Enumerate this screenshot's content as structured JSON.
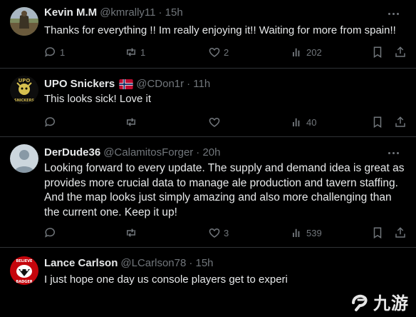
{
  "tweets": [
    {
      "name": "Kevin M.M",
      "handle": "@kmrally11",
      "time": "· 15h",
      "text": "Thanks for everything !! Im really enjoying it!! Waiting for more from spain!!",
      "replies": "1",
      "retweets": "1",
      "likes": "2",
      "views": "202"
    },
    {
      "name": "UPO Snickers",
      "handle": "@CDon1r",
      "time": "· 11h",
      "text": "This looks sick! Love it",
      "replies": "",
      "retweets": "",
      "likes": "",
      "views": "40"
    },
    {
      "name": "DerDude36",
      "handle": "@CalamitosForger",
      "time": "· 20h",
      "text": "Looking forward to every update. The supply and demand idea is great as provides more crucial data to manage ale production and tavern staffing. And the map looks just simply amazing and also more challenging than the current one. Keep it up!",
      "replies": "",
      "retweets": "",
      "likes": "3",
      "views": "539"
    },
    {
      "name": "Lance Carlson",
      "handle": "@LCarlson78",
      "time": "· 15h",
      "text": "I just hope one day us console players get to experi"
    }
  ],
  "avatar_texts": {
    "upo": "UPO",
    "snickers": "SNICKERS",
    "badger_top": "BELIEVE",
    "badger_bottom": "BADGER"
  },
  "watermark": {
    "text": "九游"
  },
  "icons": {
    "reply": "reply-icon",
    "retweet": "retweet-icon",
    "like": "heart-icon",
    "views": "views-icon",
    "bookmark": "bookmark-icon",
    "share": "share-icon",
    "more": "more-icon"
  },
  "colors": {
    "background": "#000000",
    "text": "#e7e9ea",
    "secondary": "#71767b",
    "divider": "#2f3336"
  }
}
